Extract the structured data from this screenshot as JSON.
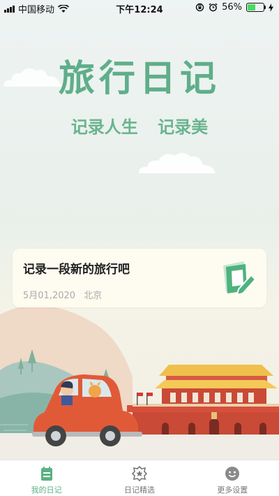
{
  "status_bar": {
    "carrier": "中国移动",
    "time": "下午12:24",
    "battery_level": 0.56,
    "battery_text": "56%"
  },
  "hero": {
    "title": "旅行日记",
    "subtitle_parts": [
      "记录人生",
      "记录美"
    ]
  },
  "card": {
    "title": "记录一段新的旅行吧",
    "date": "5月01,2020",
    "location": "北京",
    "action_icon": "edit-icon"
  },
  "tabs": [
    {
      "label": "我的日记",
      "icon": "diary-icon",
      "active": true
    },
    {
      "label": "日记精选",
      "icon": "star-badge-icon",
      "active": false
    },
    {
      "label": "更多设置",
      "icon": "smile-icon",
      "active": false
    }
  ],
  "colors": {
    "accent": "#5fae8a",
    "tab_active": "#5bb184",
    "card_bg": "#fffdf0"
  }
}
